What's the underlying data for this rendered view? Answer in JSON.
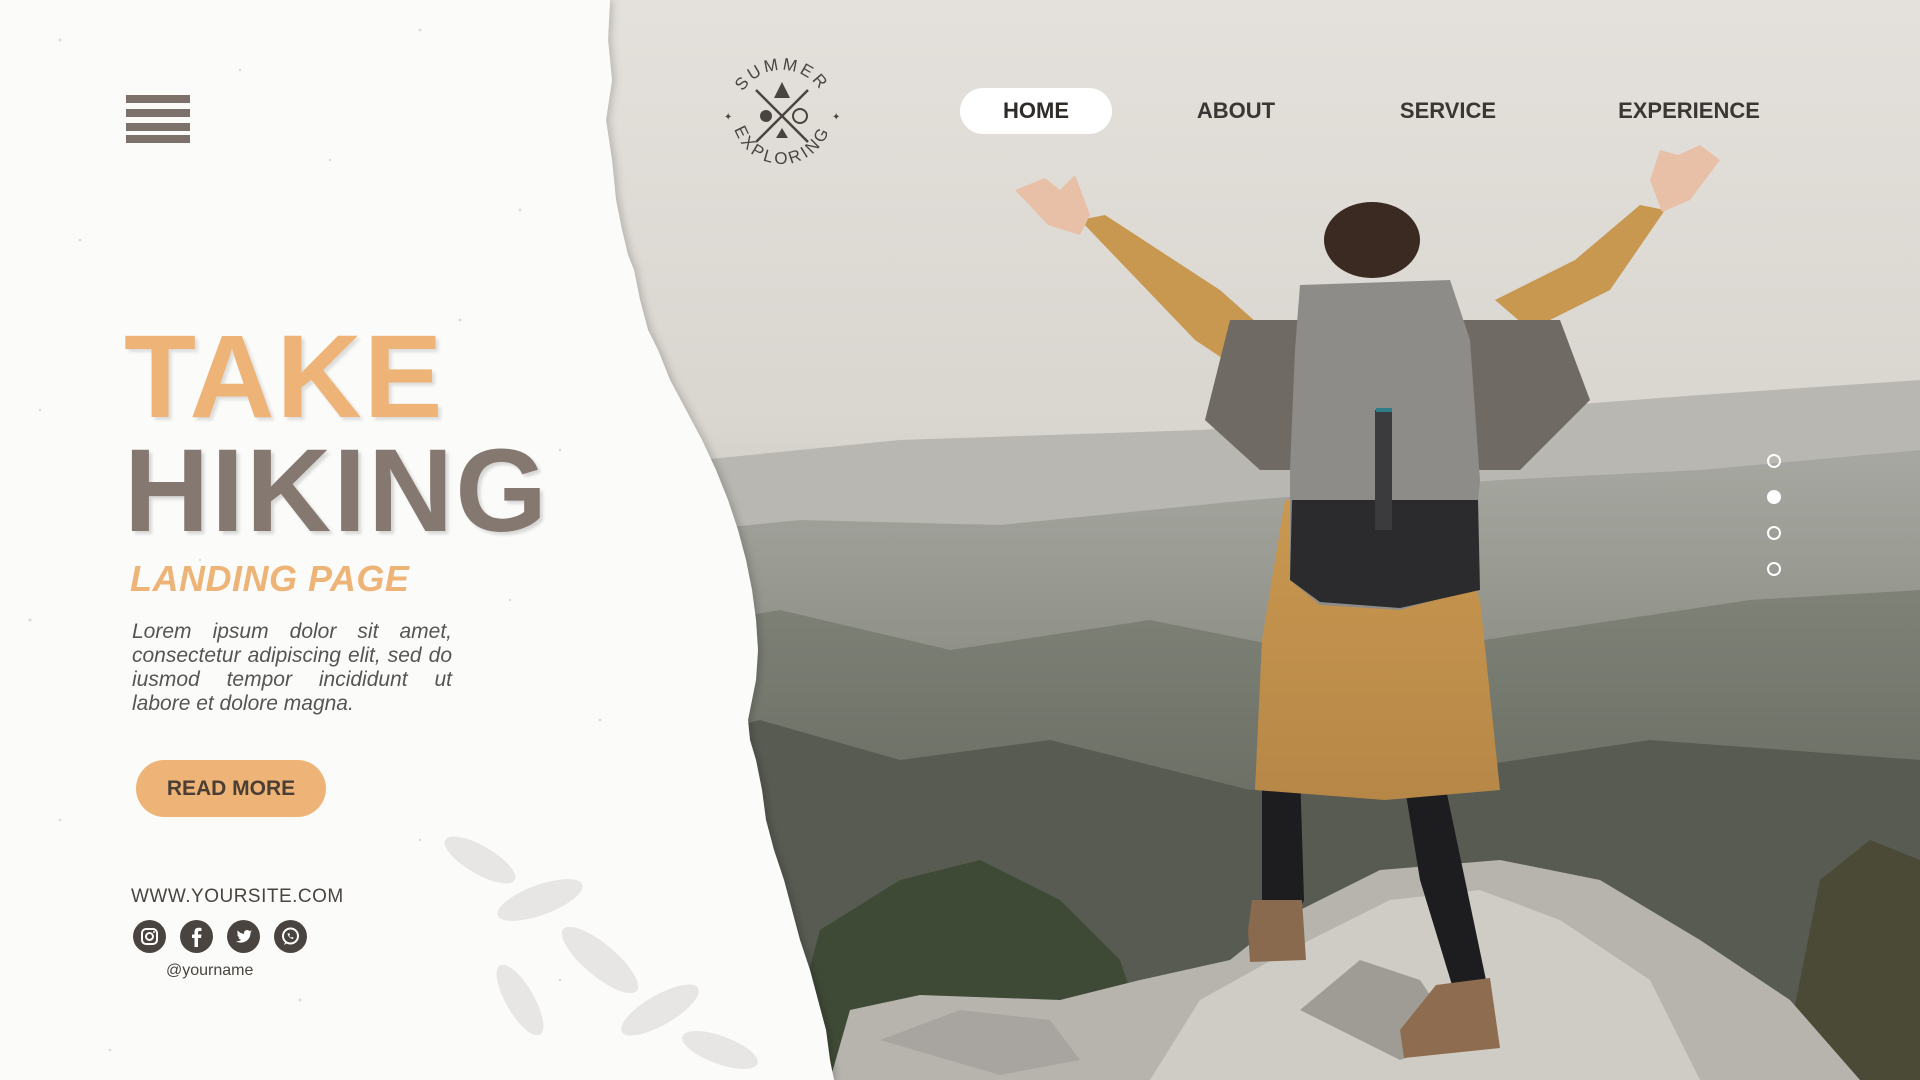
{
  "nav": {
    "items": [
      {
        "label": "HOME",
        "active": true
      },
      {
        "label": "ABOUT",
        "active": false
      },
      {
        "label": "SERVICE",
        "active": false
      },
      {
        "label": "EXPERIENCE",
        "active": false
      }
    ]
  },
  "logo": {
    "top_text": "SUMMER",
    "bottom_text": "EXPLORING"
  },
  "hero": {
    "title_line1": "TAKE",
    "title_line2": "HIKING",
    "subtitle": "LANDING PAGE",
    "body": "Lorem ipsum dolor sit amet, consectetur adipiscing elit, sed do iusmod tempor incididunt ut labore et dolore magna.",
    "cta_label": "READ MORE"
  },
  "footer": {
    "website": "WWW.YOURSITE.COM",
    "handle": "@yourname",
    "socials": [
      "instagram-icon",
      "facebook-icon",
      "twitter-icon",
      "whatsapp-icon"
    ]
  },
  "pager": {
    "count": 4,
    "active_index": 1
  },
  "colors": {
    "accent": "#eeb477",
    "dark": "#847870",
    "text": "#4a4440"
  }
}
